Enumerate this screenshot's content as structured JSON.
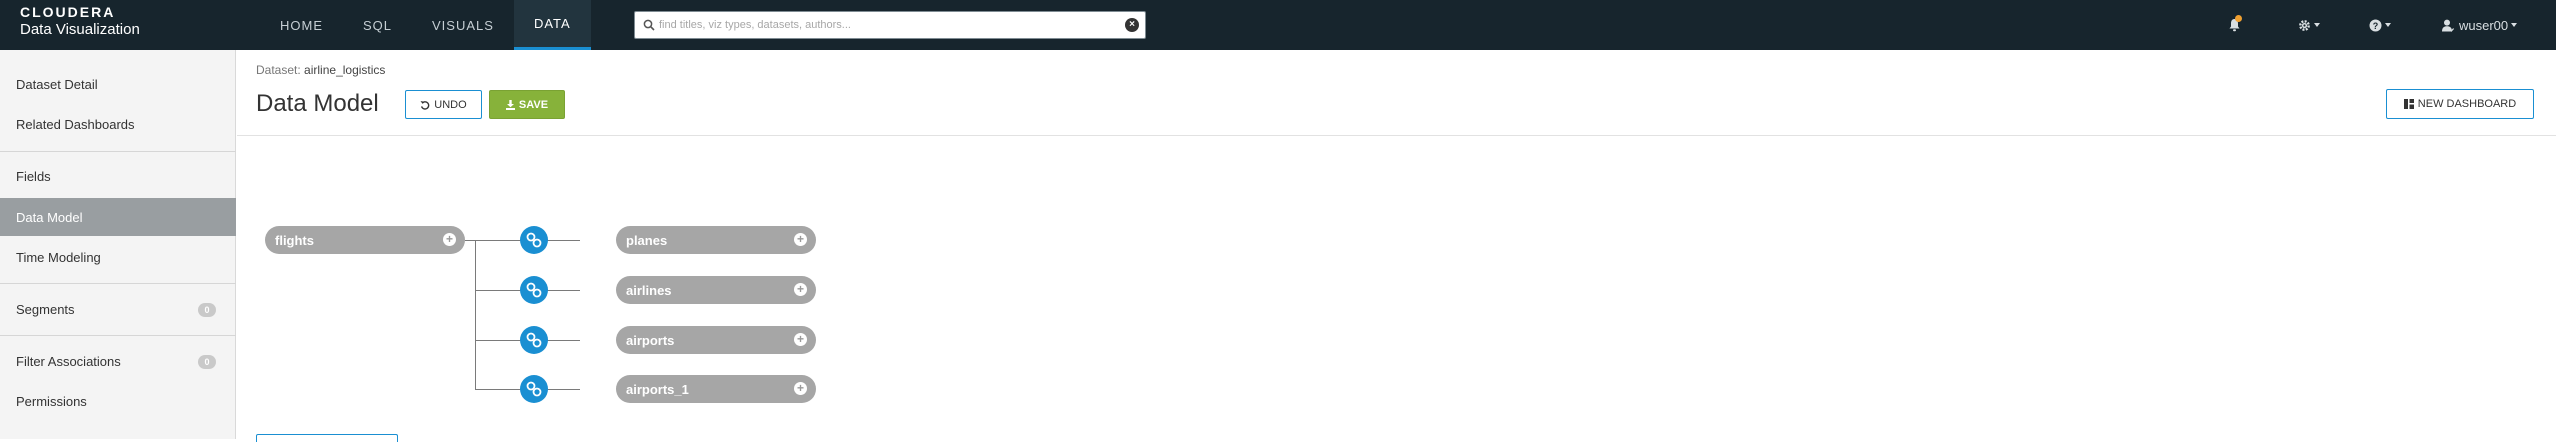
{
  "brand": {
    "line1": "CLOUDERA",
    "line2": "Data Visualization"
  },
  "nav": {
    "items": [
      {
        "label": "HOME"
      },
      {
        "label": "SQL"
      },
      {
        "label": "VISUALS"
      },
      {
        "label": "DATA",
        "active": true
      }
    ]
  },
  "search": {
    "placeholder": "find titles, viz types, datasets, authors...",
    "value": ""
  },
  "user": {
    "name": "wuser00"
  },
  "sidebar": {
    "items": [
      {
        "label": "Dataset Detail"
      },
      {
        "label": "Related Dashboards"
      },
      {
        "label": "Fields"
      },
      {
        "label": "Data Model",
        "active": true
      },
      {
        "label": "Time Modeling"
      },
      {
        "label": "Segments",
        "count": "0"
      },
      {
        "label": "Filter Associations",
        "count": "0"
      },
      {
        "label": "Permissions"
      }
    ]
  },
  "header": {
    "dataset_label": "Dataset:",
    "dataset_name": "airline_logistics",
    "title": "Data Model",
    "undo_label": "UNDO",
    "save_label": "SAVE",
    "new_dashboard_label": "NEW DASHBOARD"
  },
  "model": {
    "primary_table": "flights",
    "joined_tables": [
      "planes",
      "airlines",
      "airports",
      "airports_1"
    ]
  },
  "colors": {
    "topbar": "#17252d",
    "accent": "#1a8fd2",
    "save": "#87b23a",
    "pill": "#a6a6a6",
    "sidebar_active": "#999ea1",
    "notification_dot": "#f0a030"
  }
}
